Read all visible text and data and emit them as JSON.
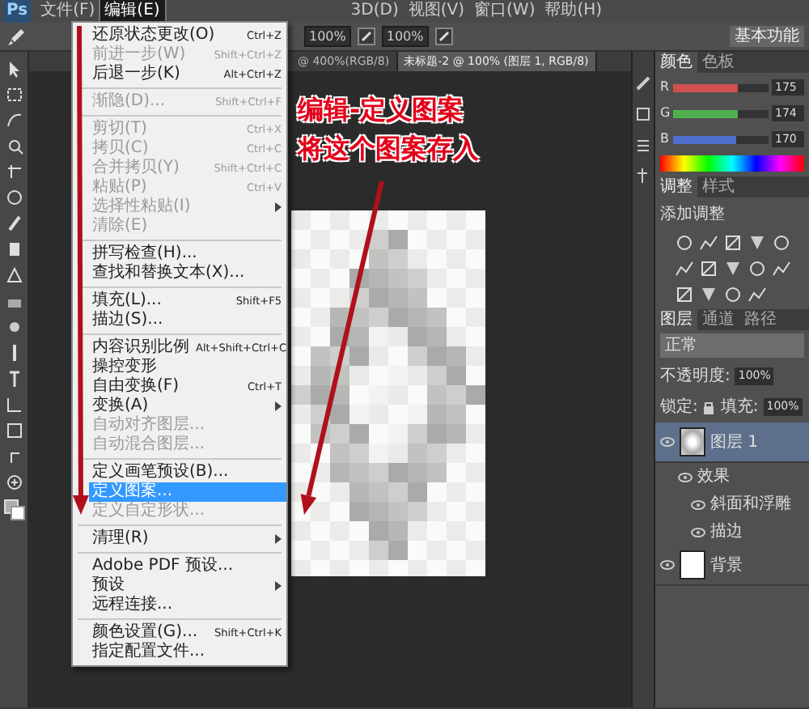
{
  "logo": "Ps",
  "menubar_left": [
    {
      "label": "文件(F)",
      "selected": false
    },
    {
      "label": "编辑(E)",
      "selected": true
    }
  ],
  "menubar_right": [
    {
      "label": "3D(D)",
      "selected": false
    },
    {
      "label": "视图(V)",
      "selected": false
    },
    {
      "label": "窗口(W)",
      "selected": false
    },
    {
      "label": "帮助(H)",
      "selected": false
    }
  ],
  "options_bar": {
    "fields": [
      "100%",
      "100%"
    ],
    "workspace": "基本功能"
  },
  "document_tabs": [
    {
      "label": "@ 400%(RGB/8)",
      "selected": false
    },
    {
      "label": "未标题-2 @ 100% (图层 1, RGB/8)",
      "selected": true
    }
  ],
  "edit_menu": [
    {
      "kind": "item",
      "label": "还原状态更改(O)",
      "shortcut": "Ctrl+Z",
      "disabled": false,
      "selected": false
    },
    {
      "kind": "item",
      "label": "前进一步(W)",
      "shortcut": "Shift+Ctrl+Z",
      "disabled": true,
      "selected": false
    },
    {
      "kind": "item",
      "label": "后退一步(K)",
      "shortcut": "Alt+Ctrl+Z",
      "disabled": false,
      "selected": false
    },
    {
      "kind": "separator"
    },
    {
      "kind": "item",
      "label": "渐隐(D)...",
      "shortcut": "Shift+Ctrl+F",
      "disabled": true,
      "selected": false
    },
    {
      "kind": "separator"
    },
    {
      "kind": "item",
      "label": "剪切(T)",
      "shortcut": "Ctrl+X",
      "disabled": true,
      "selected": false
    },
    {
      "kind": "item",
      "label": "拷贝(C)",
      "shortcut": "Ctrl+C",
      "disabled": true,
      "selected": false
    },
    {
      "kind": "item",
      "label": "合并拷贝(Y)",
      "shortcut": "Shift+Ctrl+C",
      "disabled": true,
      "selected": false
    },
    {
      "kind": "item",
      "label": "粘贴(P)",
      "shortcut": "Ctrl+V",
      "disabled": true,
      "selected": false
    },
    {
      "kind": "item",
      "label": "选择性粘贴(I)",
      "submenu": true,
      "disabled": true,
      "selected": false
    },
    {
      "kind": "item",
      "label": "清除(E)",
      "disabled": true,
      "selected": false
    },
    {
      "kind": "separator"
    },
    {
      "kind": "item",
      "label": "拼写检查(H)...",
      "disabled": false,
      "selected": false
    },
    {
      "kind": "item",
      "label": "查找和替换文本(X)...",
      "disabled": false,
      "selected": false
    },
    {
      "kind": "separator"
    },
    {
      "kind": "item",
      "label": "填充(L)...",
      "shortcut": "Shift+F5",
      "disabled": false,
      "selected": false
    },
    {
      "kind": "item",
      "label": "描边(S)...",
      "disabled": false,
      "selected": false
    },
    {
      "kind": "separator"
    },
    {
      "kind": "item",
      "label": "内容识别比例",
      "shortcut": "Alt+Shift+Ctrl+C",
      "disabled": false,
      "selected": false
    },
    {
      "kind": "item",
      "label": "操控变形",
      "disabled": false,
      "selected": false
    },
    {
      "kind": "item",
      "label": "自由变换(F)",
      "shortcut": "Ctrl+T",
      "disabled": false,
      "selected": false
    },
    {
      "kind": "item",
      "label": "变换(A)",
      "submenu": true,
      "disabled": false,
      "selected": false
    },
    {
      "kind": "item",
      "label": "自动对齐图层...",
      "disabled": true,
      "selected": false
    },
    {
      "kind": "item",
      "label": "自动混合图层...",
      "disabled": true,
      "selected": false
    },
    {
      "kind": "separator"
    },
    {
      "kind": "item",
      "label": "定义画笔预设(B)...",
      "disabled": false,
      "selected": false
    },
    {
      "kind": "item",
      "label": "定义图案...",
      "disabled": false,
      "selected": true
    },
    {
      "kind": "item",
      "label": "定义自定形状...",
      "disabled": true,
      "selected": false
    },
    {
      "kind": "separator"
    },
    {
      "kind": "item",
      "label": "清理(R)",
      "submenu": true,
      "disabled": false,
      "selected": false
    },
    {
      "kind": "separator"
    },
    {
      "kind": "item",
      "label": "Adobe PDF 预设...",
      "disabled": false,
      "selected": false
    },
    {
      "kind": "item",
      "label": "预设",
      "submenu": true,
      "disabled": false,
      "selected": false
    },
    {
      "kind": "item",
      "label": "远程连接...",
      "disabled": false,
      "selected": false
    },
    {
      "kind": "separator"
    },
    {
      "kind": "item",
      "label": "颜色设置(G)...",
      "shortcut": "Shift+Ctrl+K",
      "disabled": false,
      "selected": false
    },
    {
      "kind": "item",
      "label": "指定配置文件...",
      "disabled": false,
      "selected": false
    }
  ],
  "annotation": {
    "lines": [
      "编辑-定义图案",
      "将这个图案存入"
    ]
  },
  "color_panel": {
    "tabs": [
      {
        "label": "颜色",
        "selected": true
      },
      {
        "label": "色板",
        "selected": false
      }
    ],
    "channels": [
      {
        "name": "R",
        "level": 0.686,
        "reading": "175",
        "color": "#d05050"
      },
      {
        "name": "G",
        "level": 0.682,
        "reading": "174",
        "color": "#50b050"
      },
      {
        "name": "B",
        "level": 0.667,
        "reading": "170",
        "color": "#5070d0"
      }
    ]
  },
  "adjustments_panel": {
    "tabs": [
      {
        "label": "调整",
        "selected": true
      },
      {
        "label": "样式",
        "selected": false
      }
    ],
    "title": "添加调整"
  },
  "layers_panel": {
    "tabs": [
      {
        "label": "图层",
        "selected": true
      },
      {
        "label": "通道",
        "selected": false
      },
      {
        "label": "路径",
        "selected": false
      }
    ],
    "blend_mode": "正常",
    "opacity_label": "不透明度:",
    "opacity": "100%",
    "lock_label": "锁定:",
    "fill_label": "填充:",
    "fill": "100%",
    "layers": [
      {
        "name": "图层 1",
        "kind": "pattern",
        "selected": true,
        "visible": true,
        "children": [
          {
            "name": "效果",
            "visible": true,
            "children": [
              {
                "name": "斜面和浮雕",
                "visible": true
              },
              {
                "name": "描边",
                "visible": true
              }
            ]
          }
        ]
      },
      {
        "name": "背景",
        "kind": "white",
        "selected": false,
        "visible": true
      }
    ]
  }
}
